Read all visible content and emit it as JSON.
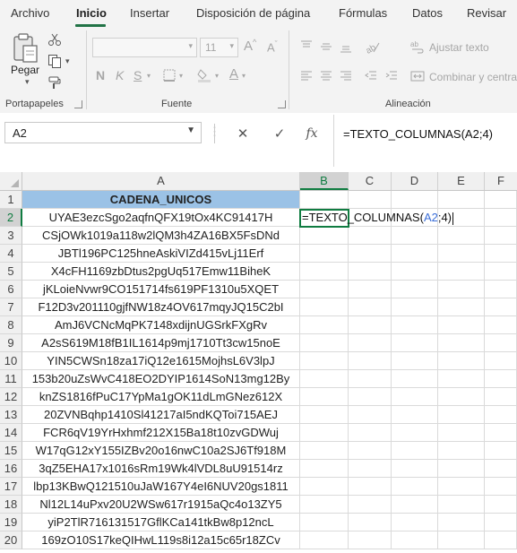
{
  "menu": {
    "tabs": [
      "Archivo",
      "Inicio",
      "Insertar",
      "Disposición de página",
      "Fórmulas",
      "Datos",
      "Revisar"
    ],
    "active_tab": "Inicio"
  },
  "ribbon": {
    "clipboard": {
      "paste_label": "Pegar",
      "group_label": "Portapapeles"
    },
    "font": {
      "font_name_value": "",
      "font_size_value": "11",
      "grow_label": "A",
      "shrink_label": "A",
      "bold": "N",
      "italic": "K",
      "underline": "S",
      "font_color_label": "A",
      "group_label": "Fuente"
    },
    "alignment": {
      "wrap_text_label": "Ajustar texto",
      "merge_center_label": "Combinar y centra",
      "group_label": "Alineación"
    }
  },
  "formula_bar": {
    "name_box_value": "A2",
    "cancel_icon": "✕",
    "enter_icon": "✓",
    "function_icon": "fx",
    "formula": "=TEXTO_COLUMNAS(A2;4)"
  },
  "sheet": {
    "columns": [
      "A",
      "B",
      "C",
      "D",
      "E",
      "F"
    ],
    "selected_column": "B",
    "selected_row": "2",
    "rows": [
      {
        "n": "1",
        "a": "CADENA_UNICOS"
      },
      {
        "n": "2",
        "a": "UYAE3ezcSgo2aqfnQFX19tOx4KC91417H"
      },
      {
        "n": "3",
        "a": "CSjOWk1019a118w2lQM3h4ZA16BX5FsDNd"
      },
      {
        "n": "4",
        "a": "JBTl196PC125hneAskiVIZd415vLj11Erf"
      },
      {
        "n": "5",
        "a": "X4cFH1169zbDtus2pgUq517Emw11BiheK"
      },
      {
        "n": "6",
        "a": "jKLoieNvwr9CO151714fs619PF1310u5XQET"
      },
      {
        "n": "7",
        "a": "F12D3v201110gjfNW18z4OV617mqyJQ15C2bI"
      },
      {
        "n": "8",
        "a": "AmJ6VCNcMqPK7148xdijnUGSrkFXgRv"
      },
      {
        "n": "9",
        "a": "A2sS619M18fB1IL1614p9mj1710Tt3cw15noE"
      },
      {
        "n": "10",
        "a": "YIN5CWSn18za17iQ12e1615MojhsL6V3lpJ"
      },
      {
        "n": "11",
        "a": "153b20uZsWvC418EO2DYIP1614SoN13mg12By"
      },
      {
        "n": "12",
        "a": "knZS1816fPuC17YpMa1gOK11dLmGNez612X"
      },
      {
        "n": "13",
        "a": "20ZVNBqhp1410Sl41217aI5ndKQToi715AEJ"
      },
      {
        "n": "14",
        "a": "FCR6qV19YrHxhmf212X15Ba18t10zvGDWuj"
      },
      {
        "n": "15",
        "a": "W17qG12xY155IZBv20o16nwC10a2SJ6Tf918M"
      },
      {
        "n": "16",
        "a": "3qZ5EHA17x1016sRm19Wk4lVDL8uU91514rz"
      },
      {
        "n": "17",
        "a": "lbp13KBwQ121510uJaW167Y4eI6NUV20gs1811"
      },
      {
        "n": "18",
        "a": "Nl12L14uPxv20U2WSw617r1915aQc4o13ZY5"
      },
      {
        "n": "19",
        "a": "yiP2TlR716131517GflKCa141tkBw8p12ncL"
      },
      {
        "n": "20",
        "a": "169zO10S17keQIHwL119s8i12a15c65r18ZCv"
      }
    ],
    "edit": {
      "prefix": "=TEXTO_COLUMNAS(",
      "ref": "A2",
      "suffix": ";4)"
    }
  }
}
